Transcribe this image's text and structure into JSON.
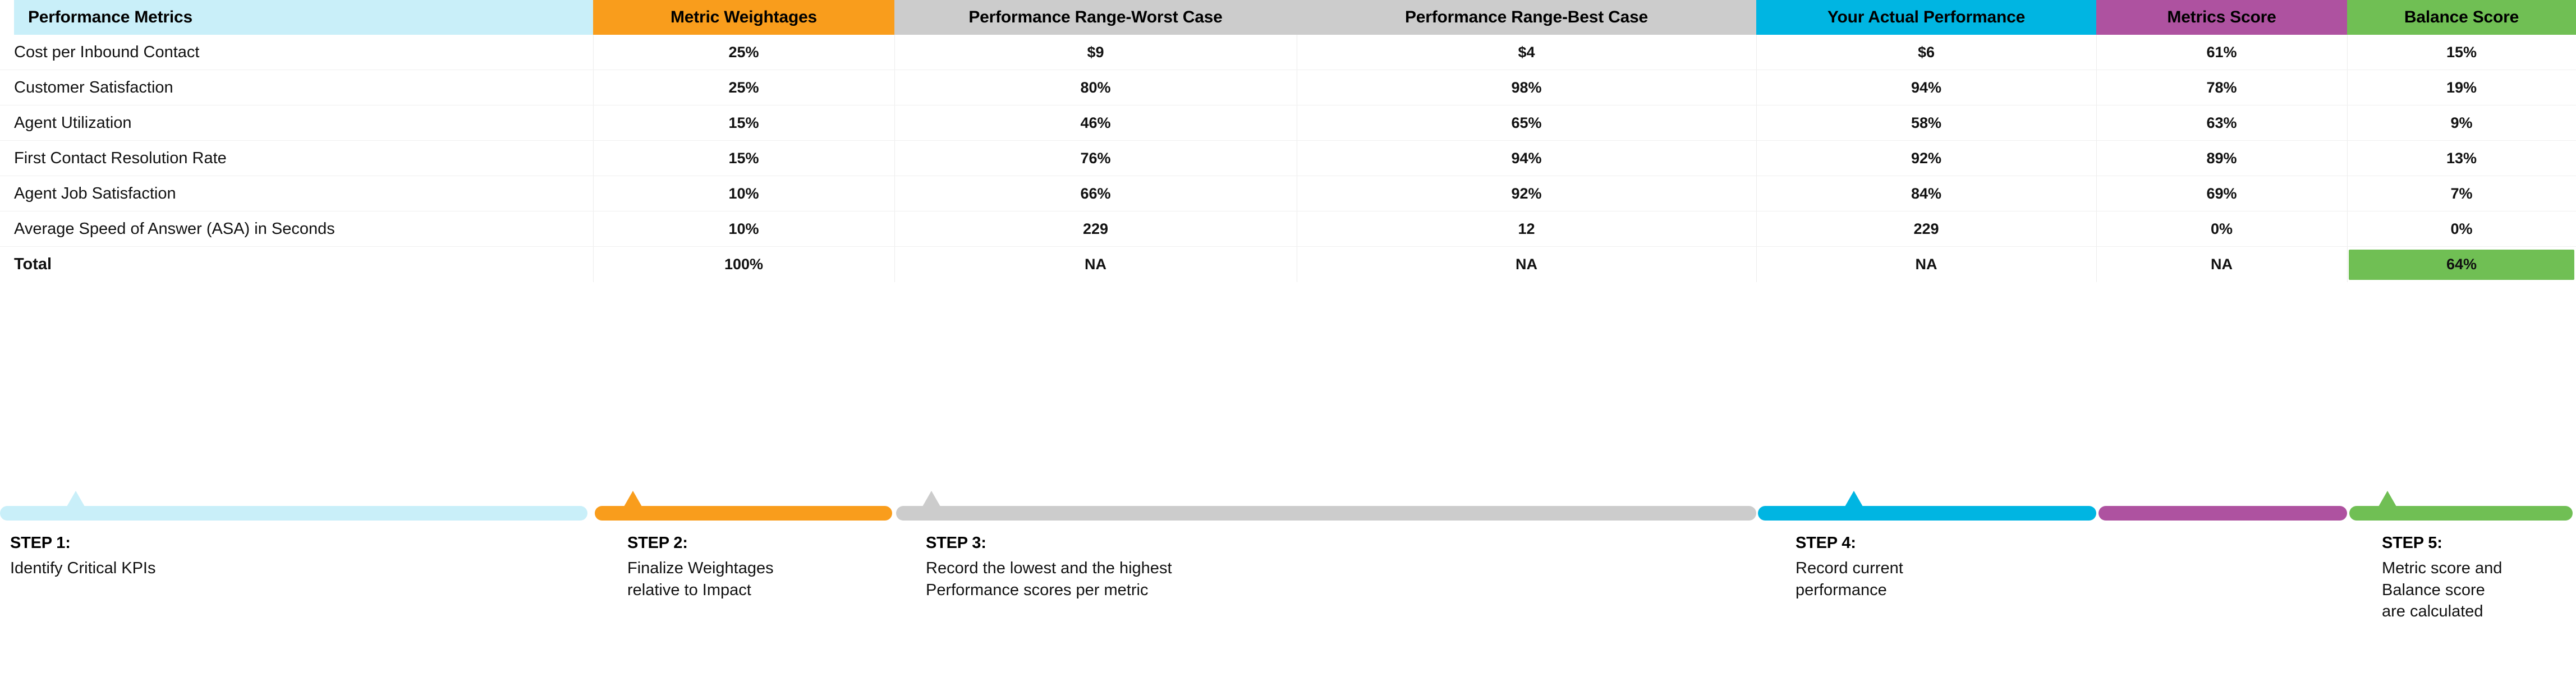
{
  "table": {
    "columns": [
      {
        "label": "Performance Metrics",
        "color": "#C9EFF9",
        "align": "left"
      },
      {
        "label": "Metric Weightages",
        "color": "#F99D1C",
        "align": "center"
      },
      {
        "label": "Performance Range-Worst Case",
        "color": "#CCCCCC",
        "align": "center"
      },
      {
        "label": "Performance Range-Best Case",
        "color": "#CCCCCC",
        "align": "center"
      },
      {
        "label": "Your Actual Performance",
        "color": "#00B5E2",
        "align": "center"
      },
      {
        "label": "Metrics Score",
        "color": "#AE52A0",
        "align": "center"
      },
      {
        "label": "Balance Score",
        "color": "#70BF54",
        "align": "center"
      }
    ],
    "rows": [
      {
        "metric": "Cost per Inbound Contact",
        "weight": "25%",
        "worst": "$9",
        "best": "$4",
        "actual": "$6",
        "metrics_score": "61%",
        "balance_score": "15%"
      },
      {
        "metric": "Customer Satisfaction",
        "weight": "25%",
        "worst": "80%",
        "best": "98%",
        "actual": "94%",
        "metrics_score": "78%",
        "balance_score": "19%"
      },
      {
        "metric": "Agent Utilization",
        "weight": "15%",
        "worst": "46%",
        "best": "65%",
        "actual": "58%",
        "metrics_score": "63%",
        "balance_score": "9%"
      },
      {
        "metric": "First Contact Resolution Rate",
        "weight": "15%",
        "worst": "76%",
        "best": "94%",
        "actual": "92%",
        "metrics_score": "89%",
        "balance_score": "13%"
      },
      {
        "metric": "Agent Job Satisfaction",
        "weight": "10%",
        "worst": "66%",
        "best": "92%",
        "actual": "84%",
        "metrics_score": "69%",
        "balance_score": "7%"
      },
      {
        "metric": "Average Speed of Answer (ASA) in Seconds",
        "weight": "10%",
        "worst": "229",
        "best": "12",
        "actual": "229",
        "metrics_score": "0%",
        "balance_score": "0%"
      }
    ],
    "total_row": {
      "metric": "Total",
      "weight": "100%",
      "worst": "NA",
      "best": "NA",
      "actual": "NA",
      "metrics_score": "NA",
      "balance_score": "64%",
      "balance_score_highlight_color": "#70BF54"
    }
  },
  "steps": [
    {
      "title": "STEP 1:",
      "desc_line1": "Identify Critical KPIs",
      "desc_line2": "",
      "desc_line3": "",
      "color": "#C9EFF9"
    },
    {
      "title": "STEP 2:",
      "desc_line1": "Finalize Weightages",
      "desc_line2": "relative to Impact",
      "desc_line3": "",
      "color": "#F99D1C"
    },
    {
      "title": "STEP 3:",
      "desc_line1": "Record the lowest and the highest",
      "desc_line2": "Performance scores per metric",
      "desc_line3": "",
      "color": "#CCCCCC"
    },
    {
      "title": "STEP 4:",
      "desc_line1": "Record current",
      "desc_line2": "performance",
      "desc_line3": "",
      "color": "#00B5E2"
    },
    {
      "title": "STEP 5:",
      "desc_line1": "Metric score and",
      "desc_line2": "Balance score",
      "desc_line3": "are calculated",
      "color": "#70BF54"
    }
  ]
}
